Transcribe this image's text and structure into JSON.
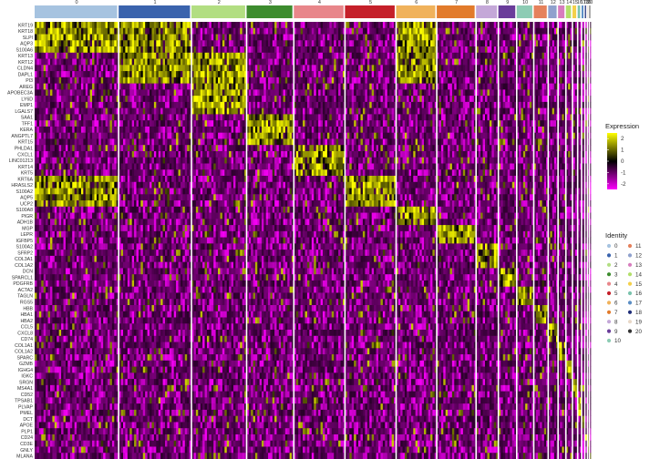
{
  "chart_data": {
    "type": "heatmap",
    "title": "",
    "xlabel": "",
    "ylabel": "",
    "clusters": [
      "0",
      "1",
      "2",
      "3",
      "4",
      "5",
      "6",
      "7",
      "8",
      "9",
      "10",
      "11",
      "12",
      "13",
      "14",
      "15",
      "16",
      "17",
      "18",
      "19",
      "20"
    ],
    "cluster_colors": [
      "#a6c3e0",
      "#3a63ad",
      "#b2de82",
      "#3d8c2e",
      "#e8868a",
      "#c5202a",
      "#f0b25b",
      "#e27b2b",
      "#c4a8d8",
      "#6a3d9a",
      "#8dccb4",
      "#e5815c",
      "#8fa1cd",
      "#d77dbd",
      "#b2df6a",
      "#f4d04a",
      "#7ac3ad",
      "#5b8ec4",
      "#1f2e78",
      "#e8d8c8",
      "#333333"
    ],
    "cluster_fractions": [
      0.1414,
      0.1226,
      0.0928,
      0.0795,
      0.0861,
      0.0861,
      0.0684,
      0.0662,
      0.0375,
      0.0309,
      0.0287,
      0.0243,
      0.0166,
      0.0132,
      0.011,
      0.0088,
      0.0066,
      0.0055,
      0.0044,
      0.0033,
      0.0022
    ],
    "genes": [
      "KRT19",
      "KRT18",
      "SLPI",
      "AQP3",
      "S100A6",
      "KRT13",
      "KRT12",
      "CLDN4",
      "DAPL1",
      "PI3",
      "AREG",
      "APOBEC3A",
      "LY6D",
      "EMP1",
      "LGALS7",
      "SAA1",
      "TFF1",
      "KERA",
      "ANGPTL7",
      "KRT15",
      "PHLDA1",
      "CXCL1",
      "LINC01213",
      "KRT14",
      "KRT5",
      "KRT6A",
      "HRASLS2",
      "S100A2",
      "AQP5",
      "UCP2",
      "S100A8",
      "PIGR",
      "ADH1B",
      "MGP",
      "LEPR",
      "IGFBP5",
      "S100A2",
      "SFRP2",
      "COL3A1",
      "COL1A2",
      "DCN",
      "SPARCL1",
      "PDGFRB",
      "ACTA2",
      "TAGLN",
      "RGS5",
      "HBB",
      "HBA1",
      "HBA2",
      "CCL5",
      "CXCL8",
      "CD74",
      "COL1A1",
      "COL1A2",
      "SPARC",
      "GZMB",
      "IGHG4",
      "IGKC",
      "SRGN",
      "MS4A1",
      "CD52",
      "TPSAB1",
      "PLVAP",
      "PMEL",
      "DCT",
      "APOE",
      "PLP1",
      "CD24",
      "CD3E",
      "GNLY",
      "MLANA"
    ],
    "gene_block_boundaries": [
      5,
      10,
      15,
      20,
      25,
      30,
      33,
      36,
      40,
      43,
      46,
      49,
      52,
      55,
      58,
      61,
      64,
      66,
      68,
      70
    ],
    "color_scale": {
      "min": -2.5,
      "max": 2.5,
      "low": "#ff00ff",
      "mid": "#000000",
      "high": "#ffff00"
    },
    "legend": {
      "expression_title": "Expression",
      "expression_ticks": [
        "2",
        "1",
        "0",
        "-1",
        "-2"
      ],
      "expression_tick_values": [
        2,
        1,
        0,
        -1,
        -2
      ],
      "identity_title": "Identity",
      "placement": "right"
    }
  }
}
